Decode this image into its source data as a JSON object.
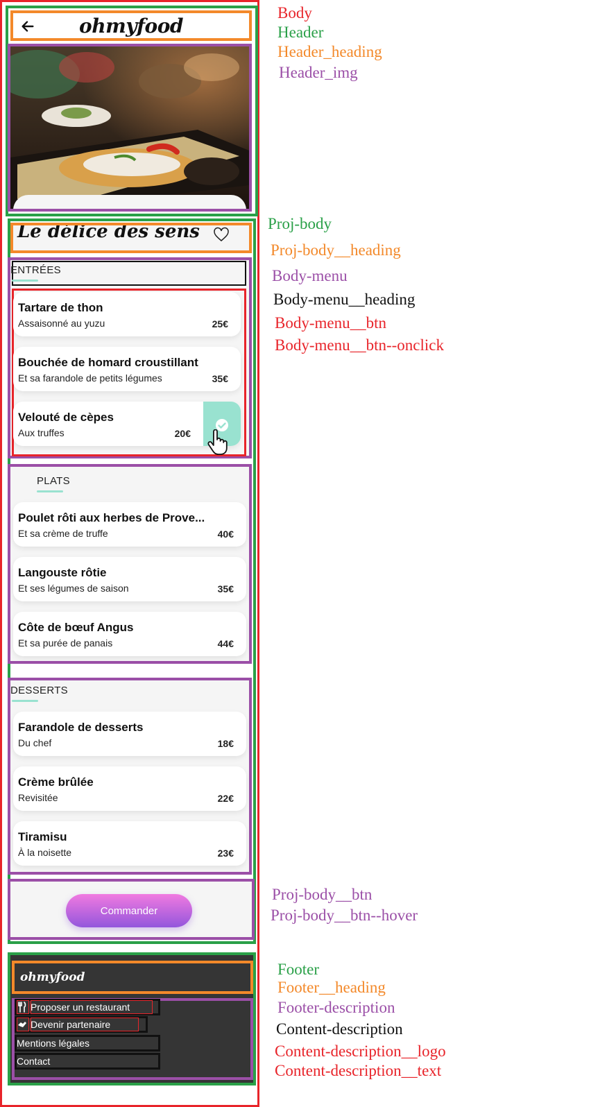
{
  "header": {
    "logo": "ohmyfood"
  },
  "project": {
    "title": "Le délice des sens"
  },
  "menus": [
    {
      "heading": "ENTRÉES",
      "items": [
        {
          "name": "Tartare de thon",
          "desc": "Assaisonné au yuzu",
          "price": "25€"
        },
        {
          "name": "Bouchée de homard croustillant",
          "desc": "Et sa farandole de petits légumes",
          "price": "35€"
        },
        {
          "name": "Velouté de cèpes",
          "desc": "Aux truffes",
          "price": "20€"
        }
      ]
    },
    {
      "heading": "PLATS",
      "items": [
        {
          "name": "Poulet rôti aux herbes de Prove...",
          "desc": "Et sa crème de truffe",
          "price": "40€"
        },
        {
          "name": "Langouste rôtie",
          "desc": "Et ses légumes de saison",
          "price": "35€"
        },
        {
          "name": "Côte de bœuf Angus",
          "desc": "Et sa purée de panais",
          "price": "44€"
        }
      ]
    },
    {
      "heading": "DESSERTS",
      "items": [
        {
          "name": "Farandole de desserts",
          "desc": "Du chef",
          "price": "18€"
        },
        {
          "name": "Crème brûlée",
          "desc": "Revisitée",
          "price": "22€"
        },
        {
          "name": "Tiramisu",
          "desc": "À la noisette",
          "price": "23€"
        }
      ]
    }
  ],
  "order_button": "Commander",
  "footer": {
    "logo": "ohmyfood",
    "links": [
      "Proposer un restaurant",
      "Devenir partenaire",
      "Mentions légales",
      "Contact"
    ]
  },
  "legend": [
    {
      "text": "Body",
      "color": "#e8242a"
    },
    {
      "text": "Header",
      "color": "#2aa048"
    },
    {
      "text": "Header_heading",
      "color": "#f3892a"
    },
    {
      "text": "Header_img",
      "color": "#9b4fa7"
    },
    {
      "text": "Proj-body",
      "color": "#2aa048"
    },
    {
      "text": "Proj-body__heading",
      "color": "#f3892a"
    },
    {
      "text": "Body-menu",
      "color": "#9b4fa7"
    },
    {
      "text": "Body-menu__heading",
      "color": "#111111"
    },
    {
      "text": "Body-menu__btn",
      "color": "#e8242a"
    },
    {
      "text": "Body-menu__btn--onclick",
      "color": "#e8242a"
    },
    {
      "text": "Proj-body__btn",
      "color": "#9b4fa7"
    },
    {
      "text": "Proj-body__btn--hover",
      "color": "#9b4fa7"
    },
    {
      "text": "Footer",
      "color": "#2aa048"
    },
    {
      "text": "Footer__heading",
      "color": "#f3892a"
    },
    {
      "text": "Footer-description",
      "color": "#9b4fa7"
    },
    {
      "text": "Content-description",
      "color": "#111111"
    },
    {
      "text": "Content-description__logo",
      "color": "#e8242a"
    },
    {
      "text": "Content-description__text",
      "color": "#e8242a"
    }
  ],
  "icons": {
    "back": "arrow-left-icon",
    "heart": "heart-outline-icon",
    "check": "check-circle-icon",
    "hand": "hand-pointer-icon",
    "cutlery": "cutlery-icon",
    "handshake": "handshake-icon"
  }
}
